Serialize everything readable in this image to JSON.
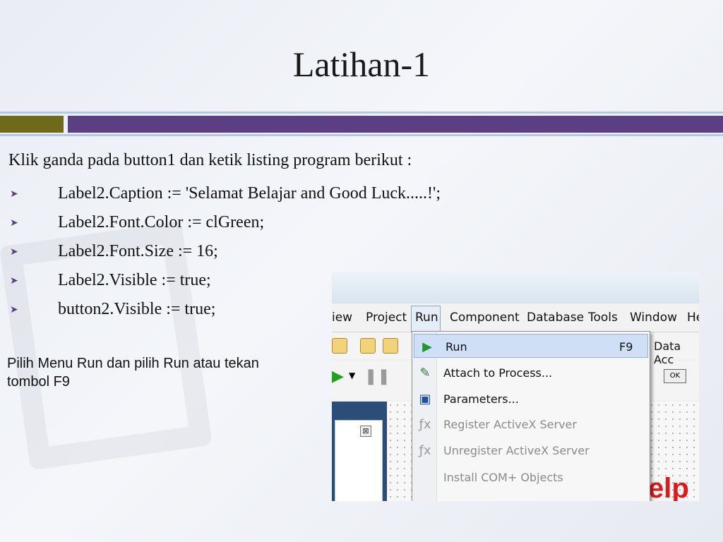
{
  "slide": {
    "title": "Latihan-1",
    "intro": "Klik ganda pada button1 dan ketik listing program berikut :",
    "bullets": [
      "Label2.Caption := 'Selamat Belajar and Good Luck.....!';",
      "Label2.Font.Color := clGreen;",
      "Label2.Font.Size := 16;",
      "Label2.Visible := true;",
      "button2.Visible := true;"
    ],
    "instruction_line1": "Pilih Menu Run dan pilih Run atau tekan",
    "instruction_line2": "tombol F9",
    "colors": {
      "accent_olive": "#6e6a1a",
      "accent_purple": "#5c3f82"
    }
  },
  "screenshot": {
    "menu": [
      "iew",
      "Project",
      "Run",
      "Component",
      "Database",
      "Tools",
      "Window",
      "He"
    ],
    "right_toolbar_label": "Data Acc",
    "ok_label": "OK",
    "close_glyph": "⊠",
    "delphi_text": "elp",
    "run_menu": {
      "items": [
        {
          "label": "Run",
          "shortcut": "F9",
          "icon": "play-icon",
          "glyph": "▶",
          "disabled": false,
          "highlighted": true
        },
        {
          "label": "Attach to Process...",
          "shortcut": "",
          "icon": "attach-icon",
          "glyph": "✎",
          "disabled": false,
          "highlighted": false
        },
        {
          "label": "Parameters...",
          "shortcut": "",
          "icon": "parameters-icon",
          "glyph": "▣",
          "disabled": false,
          "highlighted": false
        },
        {
          "label": "Register ActiveX Server",
          "shortcut": "",
          "icon": "register-icon",
          "glyph": "ƒx",
          "disabled": true,
          "highlighted": false
        },
        {
          "label": "Unregister ActiveX Server",
          "shortcut": "",
          "icon": "unregister-icon",
          "glyph": "ƒx",
          "disabled": true,
          "highlighted": false
        },
        {
          "label": "Install COM+ Objects",
          "shortcut": "",
          "icon": "",
          "glyph": "",
          "disabled": true,
          "highlighted": false
        }
      ]
    }
  }
}
